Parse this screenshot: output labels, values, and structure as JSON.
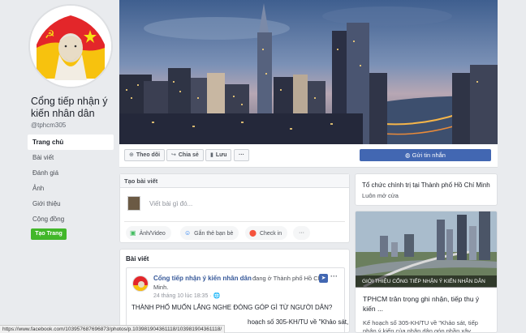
{
  "page": {
    "name": "Cổng tiếp nhận ý kiến nhân dân",
    "handle": "@tphcm305"
  },
  "nav": {
    "items": [
      {
        "label": "Trang chủ"
      },
      {
        "label": "Bài viết"
      },
      {
        "label": "Đánh giá"
      },
      {
        "label": "Ảnh"
      },
      {
        "label": "Giới thiệu"
      },
      {
        "label": "Cộng đồng"
      }
    ],
    "create_page_label": "Tạo Trang"
  },
  "actions": {
    "follow_label": "Theo dõi",
    "share_label": "Chia sẻ",
    "save_label": "Lưu",
    "more_label": "···",
    "send_message_label": "Gửi tin nhắn"
  },
  "create_post": {
    "title": "Tạo bài viết",
    "placeholder": "Viết bài gì đó...",
    "options": [
      {
        "label": "Ảnh/Video",
        "icon": "photo-icon",
        "color": "#45bd62"
      },
      {
        "label": "Gắn thẻ bạn bè",
        "icon": "tag-friends-icon",
        "color": "#1877f2"
      },
      {
        "label": "Check in",
        "icon": "location-pin-icon",
        "color": "#f5533d"
      }
    ],
    "more_label": "···"
  },
  "posts": {
    "title": "Bài viết",
    "post": {
      "author": "Cổng tiếp nhận ý kiến nhân dân",
      "checkin": "đang ở Thành phố Hồ Chí",
      "city": "Minh.",
      "time": "24 tháng 10 lúc 18:35 · 🌐",
      "text": "THÀNH PHỐ MUỐN LẮNG NGHE ĐÓNG GÓP GÌ TỪ NGƯỜI DÂN?",
      "text2": "hoạch số 305-KH/TU về \"Khảo sát,",
      "more_label": "···"
    }
  },
  "sidebar_right": {
    "org_title": "Tổ chức chính trị tại Thành phố Hồ Chí Minh",
    "org_status": "Luôn mở cửa",
    "news_caption": "GIỚI THIỆU CỔNG TIẾP NHẬN Ý KIẾN NHÂN DÂN",
    "news_title": "TPHCM trân trọng ghi nhận, tiếp thu ý kiến ...",
    "news_snippet": "Kế hoạch số 305-KH/TU về \"Khảo sát, tiếp nhận ý kiến của nhân dân góp phần xây"
  },
  "status_bar": {
    "url": "https://www.facebook.com/103957687696873/photos/p.103981904361118/103981904361118/"
  },
  "colors": {
    "brand_blue": "#4267b2",
    "link_blue": "#365899",
    "green": "#42b72a",
    "page_bg": "#e9ebee"
  }
}
